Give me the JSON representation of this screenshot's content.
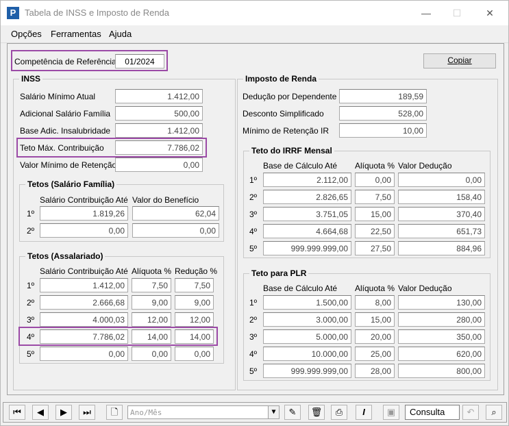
{
  "window": {
    "title": "Tabela de INSS e Imposto de Renda"
  },
  "menu": {
    "opcoes": "Opções",
    "ferramentas": "Ferramentas",
    "ajuda": "Ajuda"
  },
  "competencia": {
    "label": "Competência de Referência",
    "value": "01/2024"
  },
  "copiar_label": "Copiar",
  "inss": {
    "title": "INSS",
    "salario_minimo": {
      "label": "Salário Mínimo Atual",
      "value": "1.412,00"
    },
    "adicional_familia": {
      "label": "Adicional Salário Família",
      "value": "500,00"
    },
    "base_insalubridade": {
      "label": "Base Adic. Insalubridade",
      "value": "1.412,00"
    },
    "teto_max": {
      "label": "Teto Máx. Contribuição",
      "value": "7.786,02"
    },
    "valor_min_retencao": {
      "label": "Valor Mínimo de Retenção",
      "value": "0,00"
    }
  },
  "tetos_familia": {
    "title": "Tetos (Salário Família)",
    "col1": "Salário Contribuição Até",
    "col2": "Valor do Benefício",
    "rows": [
      {
        "idx": "1º",
        "salario": "1.819,26",
        "beneficio": "62,04"
      },
      {
        "idx": "2º",
        "salario": "0,00",
        "beneficio": "0,00"
      }
    ]
  },
  "tetos_assalariado": {
    "title": "Tetos (Assalariado)",
    "col1": "Salário Contribuição Até",
    "col2": "Alíquota %",
    "col3": "Redução %",
    "rows": [
      {
        "idx": "1º",
        "salario": "1.412,00",
        "aliquota": "7,50",
        "reducao": "7,50"
      },
      {
        "idx": "2º",
        "salario": "2.666,68",
        "aliquota": "9,00",
        "reducao": "9,00"
      },
      {
        "idx": "3º",
        "salario": "4.000,03",
        "aliquota": "12,00",
        "reducao": "12,00"
      },
      {
        "idx": "4º",
        "salario": "7.786,02",
        "aliquota": "14,00",
        "reducao": "14,00"
      },
      {
        "idx": "5º",
        "salario": "0,00",
        "aliquota": "0,00",
        "reducao": "0,00"
      }
    ]
  },
  "ir": {
    "title": "Imposto de Renda",
    "deducao_dependente": {
      "label": "Dedução por Dependente",
      "value": "189,59"
    },
    "desconto_simplificado": {
      "label": "Desconto Simplificado",
      "value": "528,00"
    },
    "minimo_retencao": {
      "label": "Mínimo de Retenção IR",
      "value": "10,00"
    }
  },
  "irrf": {
    "title": "Teto do IRRF Mensal",
    "col1": "Base de Cálculo Até",
    "col2": "Alíquota %",
    "col3": "Valor Dedução",
    "rows": [
      {
        "idx": "1º",
        "base": "2.112,00",
        "aliquota": "0,00",
        "deducao": "0,00"
      },
      {
        "idx": "2º",
        "base": "2.826,65",
        "aliquota": "7,50",
        "deducao": "158,40"
      },
      {
        "idx": "3º",
        "base": "3.751,05",
        "aliquota": "15,00",
        "deducao": "370,40"
      },
      {
        "idx": "4º",
        "base": "4.664,68",
        "aliquota": "22,50",
        "deducao": "651,73"
      },
      {
        "idx": "5º",
        "base": "999.999.999,00",
        "aliquota": "27,50",
        "deducao": "884,96"
      }
    ]
  },
  "plr": {
    "title": "Teto para PLR",
    "col1": "Base de Cálculo Até",
    "col2": "Alíquota %",
    "col3": "Valor Dedução",
    "rows": [
      {
        "idx": "1º",
        "base": "1.500,00",
        "aliquota": "8,00",
        "deducao": "130,00"
      },
      {
        "idx": "2º",
        "base": "3.000,00",
        "aliquota": "15,00",
        "deducao": "280,00"
      },
      {
        "idx": "3º",
        "base": "5.000,00",
        "aliquota": "20,00",
        "deducao": "350,00"
      },
      {
        "idx": "4º",
        "base": "10.000,00",
        "aliquota": "25,00",
        "deducao": "620,00"
      },
      {
        "idx": "5º",
        "base": "999.999.999,00",
        "aliquota": "28,00",
        "deducao": "800,00"
      }
    ]
  },
  "toolbar": {
    "search_placeholder": "Ano/Mês",
    "consulta_label": "Consulta"
  },
  "colors": {
    "highlight": "#9b4aa6",
    "app_icon": "#1f5fa8"
  }
}
